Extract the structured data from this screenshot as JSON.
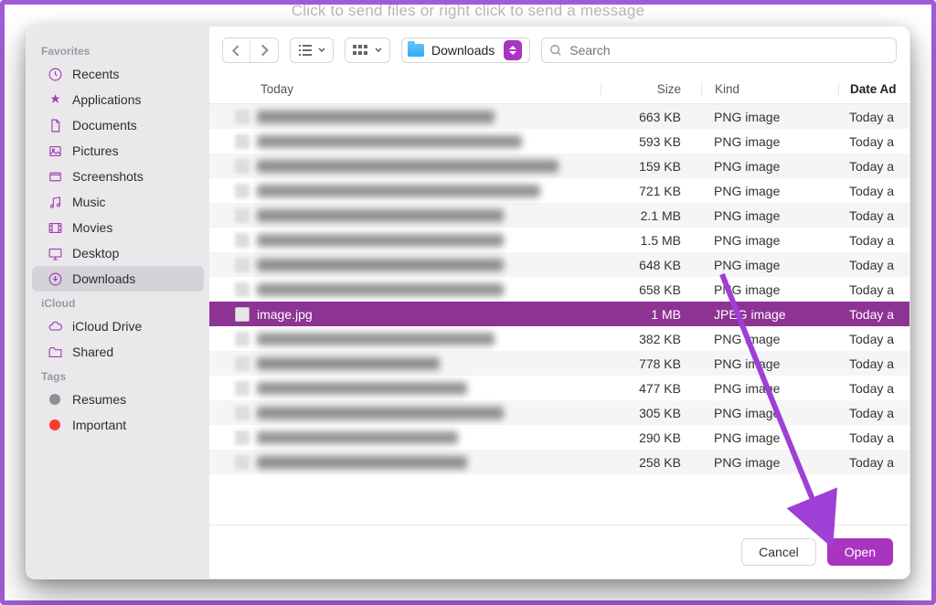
{
  "hint": "Click to send files or right click to send a message",
  "sidebar": {
    "sections": [
      {
        "label": "Favorites",
        "items": [
          {
            "icon": "recents",
            "label": "Recents"
          },
          {
            "icon": "applications",
            "label": "Applications"
          },
          {
            "icon": "documents",
            "label": "Documents"
          },
          {
            "icon": "pictures",
            "label": "Pictures"
          },
          {
            "icon": "screenshots",
            "label": "Screenshots"
          },
          {
            "icon": "music",
            "label": "Music"
          },
          {
            "icon": "movies",
            "label": "Movies"
          },
          {
            "icon": "desktop",
            "label": "Desktop"
          },
          {
            "icon": "downloads",
            "label": "Downloads",
            "selected": true
          }
        ]
      },
      {
        "label": "iCloud",
        "items": [
          {
            "icon": "icloud",
            "label": "iCloud Drive"
          },
          {
            "icon": "shared",
            "label": "Shared"
          }
        ]
      },
      {
        "label": "Tags",
        "items": [
          {
            "icon": "tag",
            "color": "#8e8e93",
            "label": "Resumes"
          },
          {
            "icon": "tag",
            "color": "#ff3b30",
            "label": "Important"
          }
        ]
      }
    ]
  },
  "toolbar": {
    "location_label": "Downloads",
    "search_placeholder": "Search"
  },
  "table": {
    "headers": {
      "name": "Today",
      "size": "Size",
      "kind": "Kind",
      "date": "Date Ad"
    },
    "rows": [
      {
        "blurred": true,
        "size": "663 KB",
        "kind": "PNG image",
        "date": "Today a",
        "nw": 260
      },
      {
        "blurred": true,
        "size": "593 KB",
        "kind": "PNG image",
        "date": "Today a",
        "nw": 290
      },
      {
        "blurred": true,
        "size": "159 KB",
        "kind": "PNG image",
        "date": "Today a",
        "nw": 330
      },
      {
        "blurred": true,
        "size": "721 KB",
        "kind": "PNG image",
        "date": "Today a",
        "nw": 310
      },
      {
        "blurred": true,
        "size": "2.1 MB",
        "kind": "PNG image",
        "date": "Today a",
        "nw": 270
      },
      {
        "blurred": true,
        "size": "1.5 MB",
        "kind": "PNG image",
        "date": "Today a",
        "nw": 270
      },
      {
        "blurred": true,
        "size": "648 KB",
        "kind": "PNG image",
        "date": "Today a",
        "nw": 270
      },
      {
        "blurred": true,
        "size": "658 KB",
        "kind": "PNG image",
        "date": "Today a",
        "nw": 270
      },
      {
        "blurred": false,
        "selected": true,
        "name": "image.jpg",
        "size": "1 MB",
        "kind": "JPEG image",
        "date": "Today a"
      },
      {
        "blurred": true,
        "size": "382 KB",
        "kind": "PNG image",
        "date": "Today a",
        "nw": 260
      },
      {
        "blurred": true,
        "size": "778 KB",
        "kind": "PNG image",
        "date": "Today a",
        "nw": 200
      },
      {
        "blurred": true,
        "size": "477 KB",
        "kind": "PNG image",
        "date": "Today a",
        "nw": 230
      },
      {
        "blurred": true,
        "size": "305 KB",
        "kind": "PNG image",
        "date": "Today a",
        "nw": 270
      },
      {
        "blurred": true,
        "size": "290 KB",
        "kind": "PNG image",
        "date": "Today a",
        "nw": 220
      },
      {
        "blurred": true,
        "size": "258 KB",
        "kind": "PNG image",
        "date": "Today a",
        "nw": 230
      }
    ]
  },
  "footer": {
    "cancel": "Cancel",
    "open": "Open"
  }
}
